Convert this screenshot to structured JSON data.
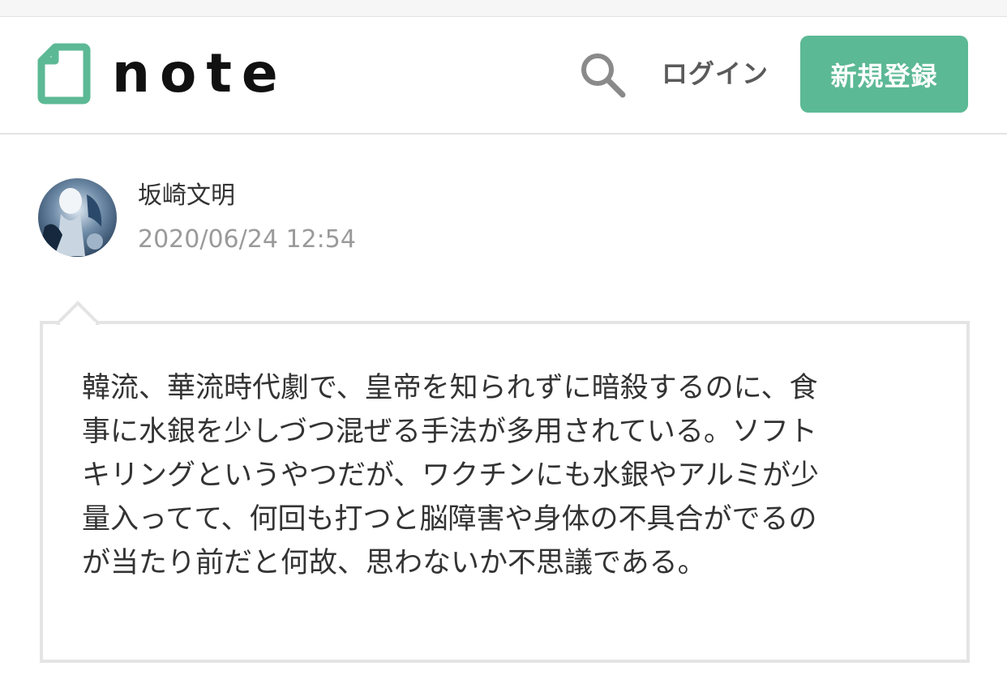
{
  "header": {
    "logo_text": "note",
    "search_icon": "search-icon",
    "login_label": "ログイン",
    "signup_label": "新規登録",
    "accent_color": "#5cb995"
  },
  "post": {
    "author": "坂崎文明",
    "date": "2020/06/24 12:54",
    "body_lines": [
      "韓流、華流時代劇で、皇帝を知られずに暗殺するのに、食",
      "事に水銀を少しづつ混ぜる手法が多用されている。ソフト",
      "キリングというやつだが、ワクチンにも水銀やアルミが少",
      "量入ってて、何回も打つと脳障害や身体の不具合がでるの",
      "が当たり前だと何故、思わないか不思議である。"
    ]
  }
}
